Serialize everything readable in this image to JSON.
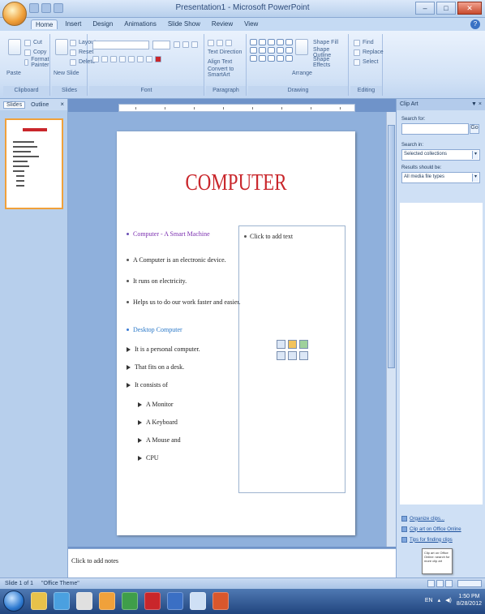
{
  "window": {
    "title": "Presentation1 - Microsoft PowerPoint",
    "controls": {
      "minimize": "–",
      "maximize": "□",
      "close": "✕"
    }
  },
  "tabs": [
    "Home",
    "Insert",
    "Design",
    "Animations",
    "Slide Show",
    "Review",
    "View"
  ],
  "help": "?",
  "ribbon": {
    "groups": [
      "Clipboard",
      "Slides",
      "Font",
      "Paragraph",
      "Drawing",
      "Editing"
    ],
    "clipboard": {
      "paste": "Paste",
      "cut": "Cut",
      "copy": "Copy",
      "format_painter": "Format Painter"
    },
    "slides": {
      "new_slide": "New Slide",
      "layout": "Layout",
      "reset": "Reset",
      "delete": "Delete"
    },
    "paragraph": {
      "text_direction": "Text Direction",
      "align_text": "Align Text",
      "convert_smartart": "Convert to SmartArt"
    },
    "drawing": {
      "arrange": "Arrange",
      "quick_styles": "Quick Styles",
      "shape_fill": "Shape Fill",
      "shape_outline": "Shape Outline",
      "shape_effects": "Shape Effects"
    },
    "editing": {
      "find": "Find",
      "replace": "Replace",
      "select": "Select"
    }
  },
  "left_pane": {
    "tab_slides": "Slides",
    "tab_outline": "Outline",
    "close": "×"
  },
  "slide": {
    "title": "COMPUTER",
    "bullets": [
      {
        "text": "Computer - A Smart Machine",
        "style": "purple",
        "marker": "dot"
      },
      {
        "text": "A Computer is an electronic device.",
        "style": "normal",
        "marker": "dot"
      },
      {
        "text": "It runs on electricity.",
        "style": "normal",
        "marker": "dot"
      },
      {
        "text": "Helps us to do our work faster and easier.",
        "style": "normal",
        "marker": "dot"
      },
      {
        "text": "Desktop Computer",
        "style": "blue",
        "marker": "dot"
      },
      {
        "text": "It is a personal computer.",
        "style": "normal",
        "marker": "arrow"
      },
      {
        "text": "That fits on a desk.",
        "style": "normal",
        "marker": "arrow"
      },
      {
        "text": "It consists of",
        "style": "normal",
        "marker": "arrow"
      },
      {
        "text": "A Monitor",
        "style": "normal",
        "marker": "arrow-indent"
      },
      {
        "text": "A Keyboard",
        "style": "normal",
        "marker": "arrow-indent"
      },
      {
        "text": "A Mouse and",
        "style": "normal",
        "marker": "arrow-indent"
      },
      {
        "text": "CPU",
        "style": "normal",
        "marker": "arrow-indent"
      }
    ],
    "placeholder_text": "Click to add text"
  },
  "notes": {
    "placeholder": "Click to add notes"
  },
  "task_pane": {
    "title": "Clip Art",
    "close": "▼ ×",
    "search_label": "Search for:",
    "search_value": "",
    "go": "Go",
    "search_in_label": "Search in:",
    "search_in_value": "Selected collections",
    "results_label": "Results should be:",
    "results_value": "All media file types",
    "links": [
      "Organize clips...",
      "Clip art on Office Online",
      "Tips for finding clips"
    ]
  },
  "tooltip": "Clip art on Office Online: search for more clip art",
  "status_bar": {
    "slide": "Slide 1 of 1",
    "theme": "\"Office Theme\""
  },
  "taskbar": {
    "language": "EN",
    "time": "1:50 PM",
    "date": "8/28/2012"
  },
  "colors": {
    "accent": "#c9262b",
    "ribbon": "#d2e2f6",
    "purple_text": "#7b2fb0",
    "blue_text": "#2a78c8"
  }
}
